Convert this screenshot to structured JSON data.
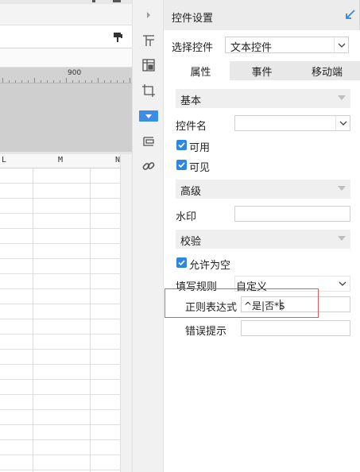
{
  "designer": {
    "ruler_label": "900",
    "columns": [
      "L",
      "M",
      "N"
    ]
  },
  "iconbar": {
    "icons": [
      "chevron-right-icon",
      "layout-icon",
      "table-grid-icon",
      "crop-frame-icon",
      "widget-icon",
      "form-icon",
      "link-icon"
    ],
    "active": "widget-icon"
  },
  "panel": {
    "title": "控件设置",
    "select_widget_label": "选择控件",
    "select_widget_value": "文本控件",
    "tabs": [
      {
        "label": "属性",
        "active": true
      },
      {
        "label": "事件",
        "active": false
      },
      {
        "label": "移动端",
        "active": false
      }
    ],
    "basic": {
      "section_label": "基本",
      "name_label": "控件名",
      "name_value": "",
      "enabled_label": "可用",
      "enabled": true,
      "visible_label": "可见",
      "visible": true
    },
    "advanced": {
      "section_label": "高级",
      "watermark_label": "水印",
      "watermark_value": ""
    },
    "validation": {
      "section_label": "校验",
      "allow_empty_label": "允许为空",
      "allow_empty": true,
      "rule_label": "填写规则",
      "rule_value": "自定义",
      "regex_label": "正则表达式",
      "regex_value": "^是|否*$",
      "error_label": "错误提示",
      "error_value": ""
    }
  },
  "colors": {
    "accent": "#2f86e0",
    "highlight_box": "#e05a5a"
  }
}
